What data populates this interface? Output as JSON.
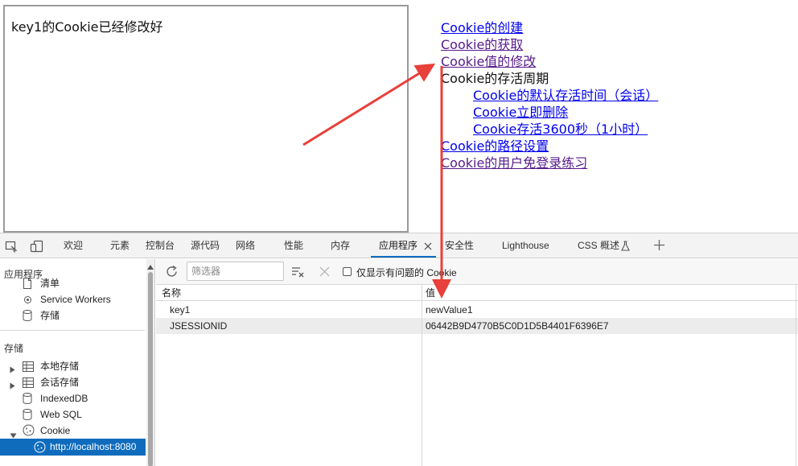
{
  "frame": {
    "message": "key1的Cookie已经修改好"
  },
  "nav": {
    "create": "Cookie的创建",
    "get": "Cookie的获取",
    "modify": "Cookie值的修改",
    "lifecycle": "Cookie的存活周期",
    "lifecycle_items": [
      "Cookie的默认存活时间（会话）",
      "Cookie立即删除",
      "Cookie存活3600秒（1小时）"
    ],
    "path": "Cookie的路径设置",
    "login": "Cookie的用户免登录练习"
  },
  "devtools": {
    "tabs": {
      "welcome": "欢迎",
      "elements": "元素",
      "console": "控制台",
      "sources": "源代码",
      "network": "网络",
      "performance": "性能",
      "memory": "内存",
      "application": "应用程序",
      "security": "安全性",
      "lighthouse": "Lighthouse",
      "css_overview": "CSS 概述"
    },
    "sidebar": {
      "app_header": "应用程序",
      "manifest": "清单",
      "service_workers": "Service Workers",
      "storage": "存储",
      "storage_header": "存储",
      "local_storage": "本地存储",
      "session_storage": "会话存储",
      "indexeddb": "IndexedDB",
      "web_sql": "Web SQL",
      "cookie": "Cookie",
      "cookie_origin": "http://localhost:8080"
    },
    "toolbar": {
      "filter_placeholder": "筛选器",
      "only_issues_label": "仅显示有问题的 Cookie"
    },
    "table": {
      "col_name": "名称",
      "col_value": "值",
      "rows": [
        {
          "name": "key1",
          "value": "newValue1"
        },
        {
          "name": "JSESSIONID",
          "value": "06442B9D4770B5C0D1D5B4401F6396E7"
        }
      ]
    }
  },
  "colors": {
    "accent": "#0f6cbd",
    "annotation_arrow": "#e8403a",
    "link": "#0000ee",
    "visited_link": "#551a8b"
  }
}
